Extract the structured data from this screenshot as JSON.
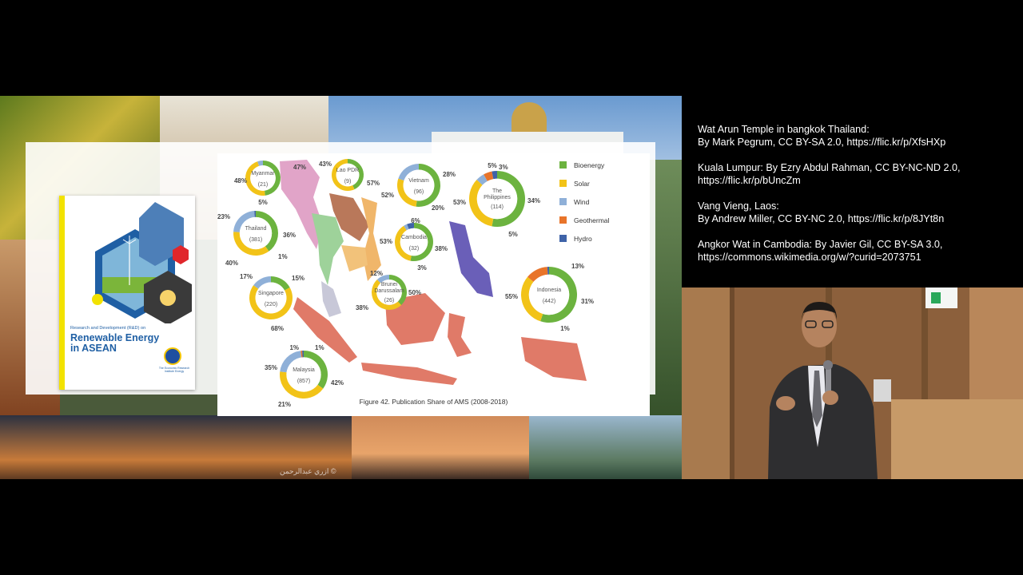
{
  "figure": {
    "caption": "Figure 42. Publication Share of AMS (2008-2018)"
  },
  "legend": [
    {
      "label": "Bioenergy",
      "color": "#6cb33f"
    },
    {
      "label": "Solar",
      "color": "#f2c318"
    },
    {
      "label": "Wind",
      "color": "#8fb0d8"
    },
    {
      "label": "Geothermal",
      "color": "#e8742a"
    },
    {
      "label": "Hydro",
      "color": "#3f63a8"
    }
  ],
  "book": {
    "subtitle": "Research and Development (R&D) on",
    "title": "Renewable Energy in ASEAN",
    "logo_text": "The Economic Research Institute Energy"
  },
  "countries": [
    {
      "name": "Myanmar",
      "count": "(21)",
      "labels": [
        "48%",
        "47%",
        "5%"
      ]
    },
    {
      "name": "Lao PDR",
      "count": "(9)",
      "labels": [
        "43%",
        "57%"
      ]
    },
    {
      "name": "Vietnam",
      "count": "(96)",
      "labels": [
        "52%",
        "28%",
        "20%"
      ]
    },
    {
      "name": "The Philippines",
      "count": "(114)",
      "labels": [
        "53%",
        "5%",
        "3%",
        "34%",
        "5%"
      ]
    },
    {
      "name": "Thailand",
      "count": "(381)",
      "labels": [
        "23%",
        "36%",
        "40%",
        "1%"
      ]
    },
    {
      "name": "Cambodia",
      "count": "(32)",
      "labels": [
        "6%",
        "53%",
        "38%",
        "3%"
      ]
    },
    {
      "name": "Singapore",
      "count": "(220)",
      "labels": [
        "17%",
        "15%",
        "68%"
      ]
    },
    {
      "name": "Brunei Darussalam",
      "count": "(26)",
      "labels": [
        "12%",
        "38%",
        "50%"
      ]
    },
    {
      "name": "Indonesia",
      "count": "(442)",
      "labels": [
        "13%",
        "55%",
        "31%",
        "1%"
      ]
    },
    {
      "name": "Malaysia",
      "count": "(857)",
      "labels": [
        "1%",
        "1%",
        "35%",
        "42%",
        "21%"
      ]
    }
  ],
  "chart_data": {
    "type": "pie",
    "title": "Figure 42. Publication Share of AMS (2008-2018)",
    "categories": [
      "Bioenergy",
      "Solar",
      "Wind",
      "Geothermal",
      "Hydro"
    ],
    "series": [
      {
        "name": "Myanmar",
        "total": 21,
        "values": [
          48,
          47,
          5,
          0,
          0
        ]
      },
      {
        "name": "Lao PDR",
        "total": 9,
        "values": [
          43,
          57,
          0,
          0,
          0
        ]
      },
      {
        "name": "Vietnam",
        "total": 96,
        "values": [
          52,
          28,
          20,
          0,
          0
        ]
      },
      {
        "name": "The Philippines",
        "total": 114,
        "values": [
          53,
          34,
          5,
          5,
          3
        ]
      },
      {
        "name": "Thailand",
        "total": 381,
        "values": [
          40,
          36,
          23,
          0,
          1
        ]
      },
      {
        "name": "Cambodia",
        "total": 32,
        "values": [
          53,
          38,
          3,
          0,
          6
        ]
      },
      {
        "name": "Singapore",
        "total": 220,
        "values": [
          17,
          68,
          15,
          0,
          0
        ]
      },
      {
        "name": "Brunei Darussalam",
        "total": 26,
        "values": [
          38,
          50,
          12,
          0,
          0
        ]
      },
      {
        "name": "Indonesia",
        "total": 442,
        "values": [
          55,
          31,
          0,
          13,
          1
        ]
      },
      {
        "name": "Malaysia",
        "total": 857,
        "values": [
          35,
          42,
          21,
          1,
          1
        ]
      }
    ],
    "legend": "right"
  },
  "credits": [
    {
      "line1": "Wat Arun Temple in bangkok Thailand:",
      "line2": "By Mark Pegrum, CC BY-SA 2.0, https://flic.kr/p/XfsHXp"
    },
    {
      "line1": "Kuala Lumpur: By Ezry Abdul Rahman, CC BY-NC-ND 2.0,",
      "line2": "https://flic.kr/p/bUncZm"
    },
    {
      "line1": "Vang Vieng, Laos:",
      "line2": "By Andrew Miller, CC BY-NC 2.0, https://flic.kr/p/8JYt8n"
    },
    {
      "line1": "Angkor Wat in Cambodia: By Javier Gil, CC BY-SA 3.0,",
      "line2": "https://commons.wikimedia.org/w/?curid=2073751"
    }
  ],
  "watermark": "ازري عبدالرحمن ©"
}
